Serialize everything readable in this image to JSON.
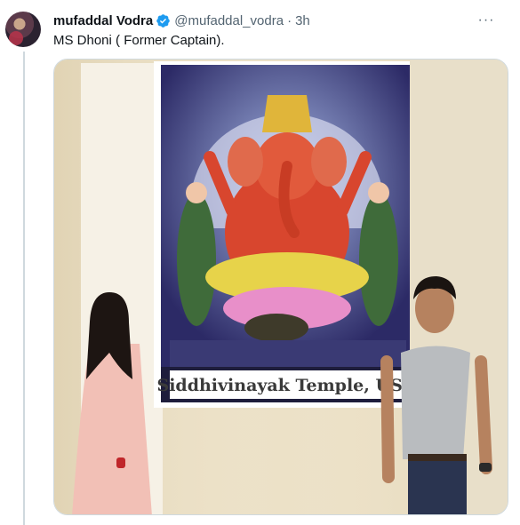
{
  "tweet": {
    "display_name": "mufaddal Vodra",
    "handle": "@mufaddal_vodra",
    "separator": "·",
    "time": "3h",
    "text": "MS Dhoni ( Former Captain).",
    "more_label": "···"
  },
  "media": {
    "sign_text": "Siddhivinayak Temple, USA"
  },
  "icons": {
    "avatar": "profile-avatar",
    "verified": "verified-badge-icon",
    "more": "more-options-icon"
  },
  "colors": {
    "verified_blue": "#1d9bf0",
    "text_primary": "#0f1419",
    "text_secondary": "#536471",
    "thread_line": "#cfd9de"
  }
}
